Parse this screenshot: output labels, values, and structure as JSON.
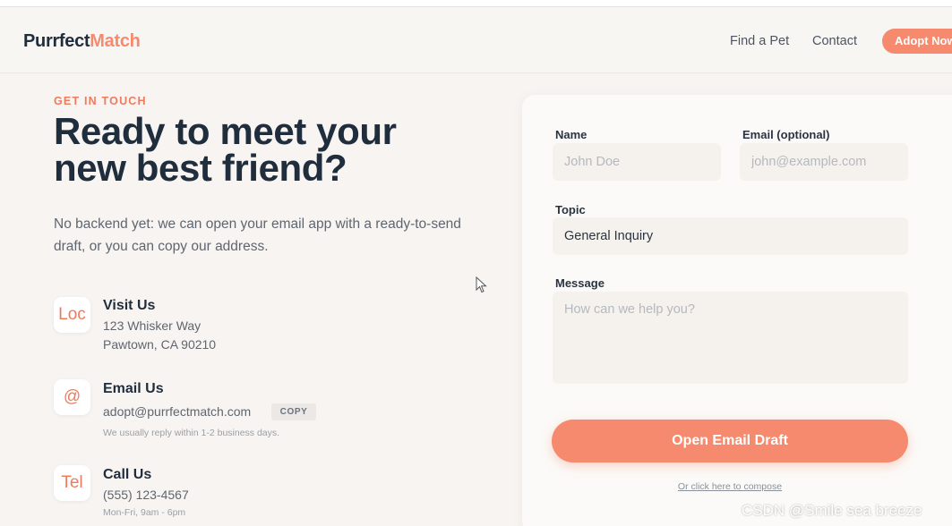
{
  "header": {
    "logo_part1": "Purrfect",
    "logo_part2": "Match",
    "nav": [
      "Find a Pet",
      "Contact"
    ],
    "cta_label": "Adopt Now"
  },
  "hero": {
    "eyebrow": "GET IN TOUCH",
    "headline_line1": "Ready to meet your",
    "headline_line2": "new best friend?",
    "intro": "No backend yet: we can open your email app with a ready-to-send draft, or you can copy our address."
  },
  "contacts": {
    "visit": {
      "icon_text": "Loc",
      "icon": "location-icon",
      "title": "Visit Us",
      "line1": "123 Whisker Way",
      "line2": "Pawtown, CA 90210"
    },
    "email": {
      "icon_text": "@",
      "icon": "at-sign-icon",
      "title": "Email Us",
      "address": "adopt@purrfectmatch.com",
      "copy_label": "COPY",
      "note": "We usually reply within 1-2 business days."
    },
    "call": {
      "icon_text": "Tel",
      "icon": "phone-icon",
      "title": "Call Us",
      "number": "(555) 123-4567",
      "hours": "Mon-Fri, 9am - 6pm"
    }
  },
  "form": {
    "name_label": "Name",
    "name_placeholder": "John Doe",
    "email_label": "Email (optional)",
    "email_placeholder": "john@example.com",
    "topic_label": "Topic",
    "topic_value": "General Inquiry",
    "message_label": "Message",
    "message_placeholder": "How can we help you?",
    "submit_label": "Open Email Draft",
    "alt_link": "Or click here to compose"
  },
  "watermark": "CSDN @Smile sea breeze",
  "colors": {
    "accent": "#f58a6e",
    "heading": "#1f2d3d",
    "background": "#f7f4f1"
  }
}
